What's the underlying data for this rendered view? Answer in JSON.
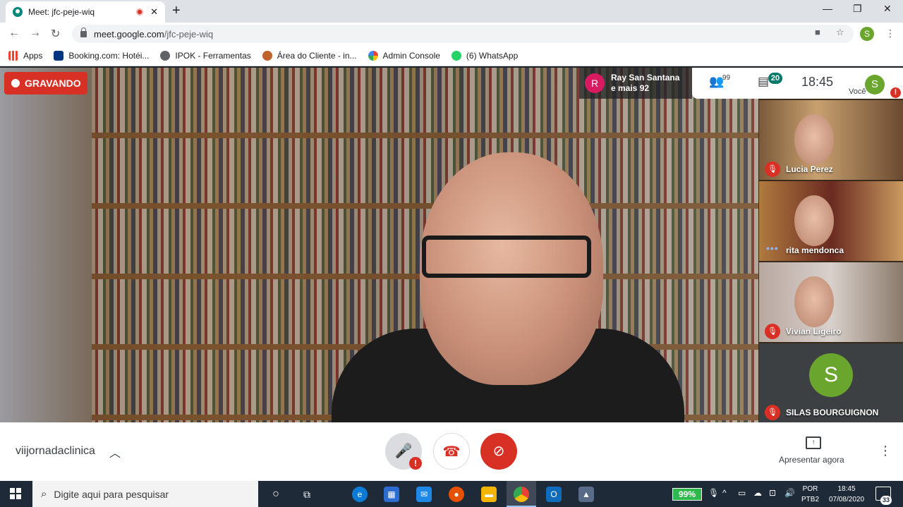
{
  "browser": {
    "tab_title": "Meet: jfc-peje-wiq",
    "url_host": "meet.google.com",
    "url_path": "/jfc-peje-wiq",
    "profile_initial": "S",
    "bookmarks": [
      {
        "label": "Apps",
        "icon": "apps-grid-icon"
      },
      {
        "label": "Booking.com: Hotéi...",
        "icon": "booking-icon"
      },
      {
        "label": "IPOK - Ferramentas",
        "icon": "globe-icon"
      },
      {
        "label": "Área do Cliente - in...",
        "icon": "client-area-icon"
      },
      {
        "label": "Admin Console",
        "icon": "google-g-icon"
      },
      {
        "label": "(6) WhatsApp",
        "icon": "whatsapp-icon"
      }
    ]
  },
  "meet": {
    "recording_label": "GRAVANDO",
    "speaker": {
      "initial": "R",
      "name": "Ray San Santana",
      "more": "e mais 92"
    },
    "people_count": "99",
    "chat_count": "20",
    "time": "18:45",
    "you_label": "Você",
    "you_initial": "S",
    "tiles": [
      {
        "name": "Lucia Perez",
        "muted": true
      },
      {
        "name": "rita mendonca",
        "muted": false
      },
      {
        "name": "Vivian Ligeiro",
        "muted": true
      },
      {
        "name": "SILAS BOURGUIGNON",
        "muted": true,
        "initial": "S"
      }
    ],
    "meeting_name": "viijornadaclinica",
    "present_label": "Apresentar agora"
  },
  "taskbar": {
    "search_placeholder": "Digite aqui para pesquisar",
    "battery": "99%",
    "lang_top": "POR",
    "lang_bottom": "PTB2",
    "clock_time": "18:45",
    "clock_date": "07/08/2020",
    "notification_count": "33"
  },
  "colors": {
    "record_red": "#d93025",
    "avatar_green": "#6aa62e",
    "avatar_pink": "#d81b60",
    "chat_badge": "#00796b"
  }
}
